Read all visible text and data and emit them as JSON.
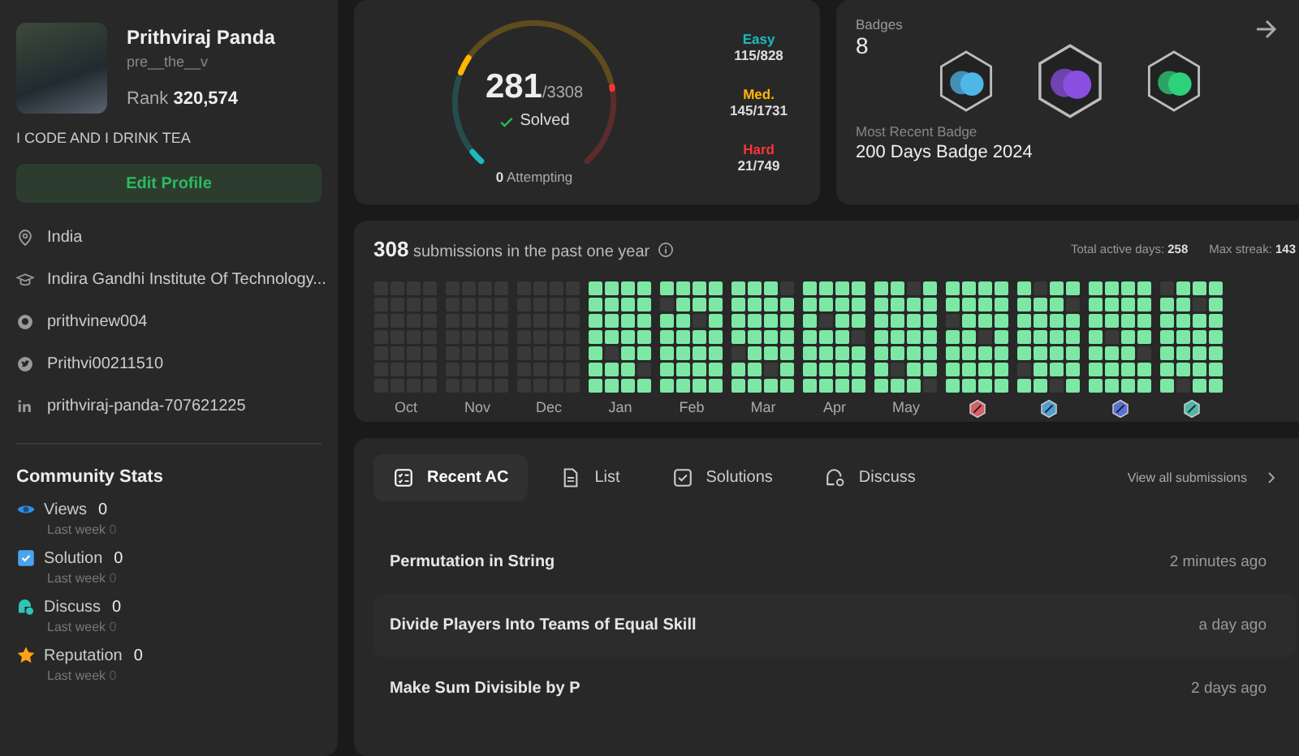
{
  "profile": {
    "name": "Prithviraj Panda",
    "username": "pre__the__v",
    "rank_label": "Rank",
    "rank": "320,574",
    "bio": "I CODE AND I DRINK TEA",
    "edit_button": "Edit Profile",
    "details": [
      {
        "kind": "location",
        "text": "India"
      },
      {
        "kind": "school",
        "text": "Indira Gandhi Institute Of Technology..."
      },
      {
        "kind": "github",
        "text": "prithvinew004"
      },
      {
        "kind": "twitter",
        "text": "Prithvi00211510"
      },
      {
        "kind": "linkedin",
        "text": "prithviraj-panda-707621225"
      }
    ]
  },
  "community_stats": {
    "title": "Community Stats",
    "items": [
      {
        "kind": "views",
        "label": "Views",
        "value": "0",
        "sub_label": "Last week",
        "sub_value": "0"
      },
      {
        "kind": "solution",
        "label": "Solution",
        "value": "0",
        "sub_label": "Last week",
        "sub_value": "0"
      },
      {
        "kind": "discuss",
        "label": "Discuss",
        "value": "0",
        "sub_label": "Last week",
        "sub_value": "0"
      },
      {
        "kind": "reputation",
        "label": "Reputation",
        "value": "0",
        "sub_label": "Last week",
        "sub_value": "0"
      }
    ]
  },
  "solved": {
    "count": "281",
    "total": "/3308",
    "label": "Solved",
    "attempting_count": "0",
    "attempting_label": "Attempting",
    "levels": [
      {
        "kind": "easy",
        "label": "Easy",
        "value": "115/828"
      },
      {
        "kind": "medium",
        "label": "Med.",
        "value": "145/1731"
      },
      {
        "kind": "hard",
        "label": "Hard",
        "value": "21/749"
      }
    ]
  },
  "badges": {
    "title": "Badges",
    "count": "8",
    "recent_label": "Most Recent Badge",
    "recent": "200 Days Badge 2024",
    "items": [
      {
        "color": "#4fb6e8"
      },
      {
        "color": "#8a4fe0"
      },
      {
        "color": "#2fd07a"
      }
    ]
  },
  "submissions": {
    "count": "308",
    "text": "submissions in the past one year",
    "active_days_label": "Total active days:",
    "active_days": "258",
    "max_streak_label": "Max streak:",
    "max_streak": "143",
    "months": [
      {
        "label": "Oct",
        "active": false
      },
      {
        "label": "Nov",
        "active": false
      },
      {
        "label": "Dec",
        "active": false
      },
      {
        "label": "Jan",
        "active": true
      },
      {
        "label": "Feb",
        "active": true
      },
      {
        "label": "Mar",
        "active": true
      },
      {
        "label": "Apr",
        "active": true
      },
      {
        "label": "May",
        "active": true
      },
      {
        "color": "#d8606a",
        "active": true
      },
      {
        "color": "#4fa0d0",
        "active": true
      },
      {
        "color": "#5a6fd8",
        "active": true
      },
      {
        "color": "#4fb8a8",
        "active": true
      }
    ]
  },
  "tabs": [
    {
      "kind": "recent",
      "label": "Recent AC",
      "selected": true
    },
    {
      "kind": "list",
      "label": "List",
      "selected": false
    },
    {
      "kind": "solutions",
      "label": "Solutions",
      "selected": false
    },
    {
      "kind": "discuss",
      "label": "Discuss",
      "selected": false
    }
  ],
  "view_all": "View all submissions",
  "recent": [
    {
      "title": "Permutation in String",
      "time": "2 minutes ago"
    },
    {
      "title": "Divide Players Into Teams of Equal Skill",
      "time": "a day ago"
    },
    {
      "title": "Make Sum Divisible by P",
      "time": "2 days ago"
    }
  ]
}
